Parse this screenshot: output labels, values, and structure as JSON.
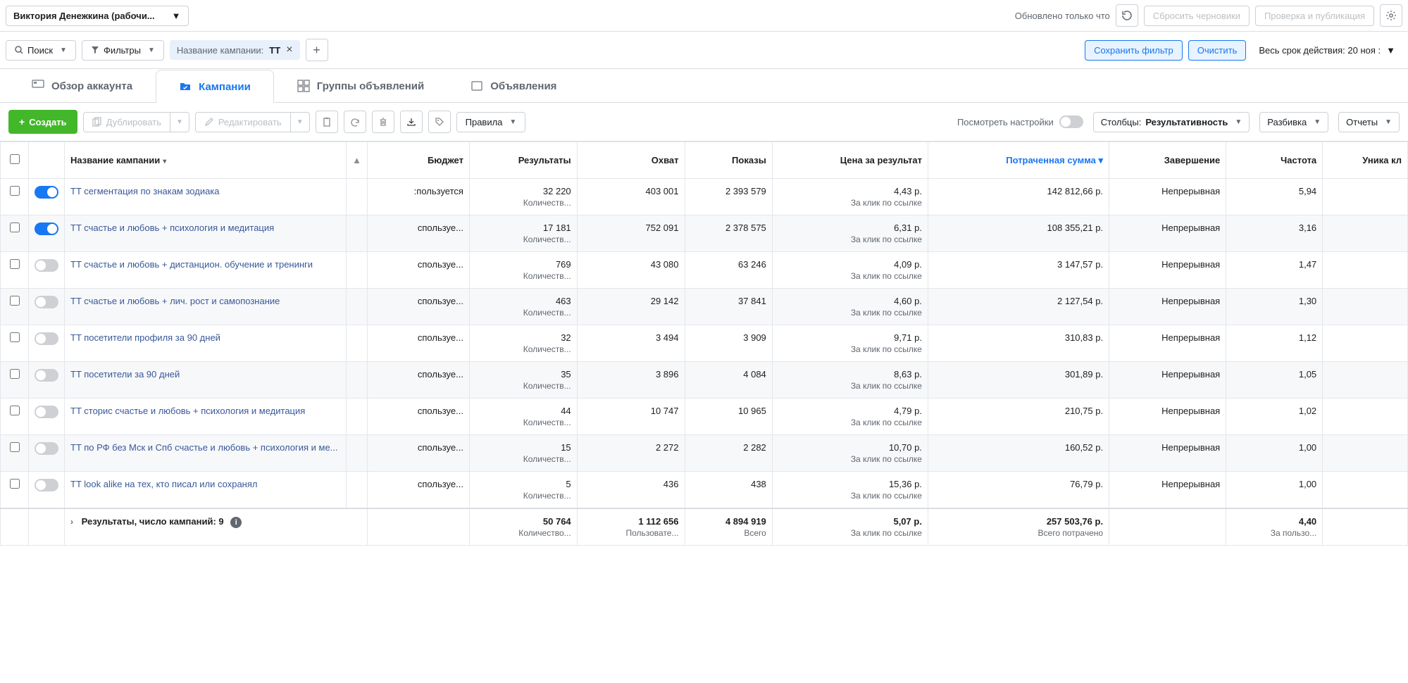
{
  "topbar": {
    "account": "Виктория Денежкина (рабочи...",
    "updated": "Обновлено только что",
    "discard": "Сбросить черновики",
    "review": "Проверка и публикация"
  },
  "filterbar": {
    "search": "Поиск",
    "filters": "Фильтры",
    "chip": {
      "label": "Название кампании:",
      "value": "TT"
    },
    "save": "Сохранить фильтр",
    "clear": "Очистить",
    "daterange": "Весь срок действия: 20 ноя :"
  },
  "tabs": {
    "overview": "Обзор аккаунта",
    "campaigns": "Кампании",
    "adsets": "Группы объявлений",
    "ads": "Объявления"
  },
  "toolbar": {
    "create": "Создать",
    "duplicate": "Дублировать",
    "edit": "Редактировать",
    "rules": "Правила",
    "preview": "Посмотреть настройки",
    "columns_lbl": "Столбцы:",
    "columns_val": "Результативность",
    "breakdown": "Разбивка",
    "reports": "Отчеты"
  },
  "columns": {
    "name": "Название кампании",
    "budget": "Бюджет",
    "results": "Результаты",
    "reach": "Охват",
    "impressions": "Показы",
    "cpr": "Цена за результат",
    "spent": "Потраченная сумма",
    "ends": "Завершение",
    "frequency": "Частота",
    "unique": "Уника кл"
  },
  "rows": [
    {
      "on": true,
      "name": "TT сегментация по знакам зодиака",
      "budget": ":пользуется",
      "results": "32 220",
      "res_sub": "Количеств...",
      "reach": "403 001",
      "imp": "2 393 579",
      "cpr": "4,43 р.",
      "cpr_sub": "За клик по ссылке",
      "spent": "142 812,66 р.",
      "ends": "Непрерывная",
      "freq": "5,94"
    },
    {
      "on": true,
      "name": "TT счастье и любовь + психология и медитация",
      "budget": "спользуе...",
      "results": "17 181",
      "res_sub": "Количеств...",
      "reach": "752 091",
      "imp": "2 378 575",
      "cpr": "6,31 р.",
      "cpr_sub": "За клик по ссылке",
      "spent": "108 355,21 р.",
      "ends": "Непрерывная",
      "freq": "3,16"
    },
    {
      "on": false,
      "name": "TT счастье и любовь + дистанцион. обучение и тренинги",
      "budget": "спользуе...",
      "results": "769",
      "res_sub": "Количеств...",
      "reach": "43 080",
      "imp": "63 246",
      "cpr": "4,09 р.",
      "cpr_sub": "За клик по ссылке",
      "spent": "3 147,57 р.",
      "ends": "Непрерывная",
      "freq": "1,47"
    },
    {
      "on": false,
      "name": "TT счастье и любовь + лич. рост и самопознание",
      "budget": "спользуе...",
      "results": "463",
      "res_sub": "Количеств...",
      "reach": "29 142",
      "imp": "37 841",
      "cpr": "4,60 р.",
      "cpr_sub": "За клик по ссылке",
      "spent": "2 127,54 р.",
      "ends": "Непрерывная",
      "freq": "1,30"
    },
    {
      "on": false,
      "name": "TT посетители профиля за 90 дней",
      "budget": "спользуе...",
      "results": "32",
      "res_sub": "Количеств...",
      "reach": "3 494",
      "imp": "3 909",
      "cpr": "9,71 р.",
      "cpr_sub": "За клик по ссылке",
      "spent": "310,83 р.",
      "ends": "Непрерывная",
      "freq": "1,12"
    },
    {
      "on": false,
      "name": "TT посетители за 90 дней",
      "budget": "спользуе...",
      "results": "35",
      "res_sub": "Количеств...",
      "reach": "3 896",
      "imp": "4 084",
      "cpr": "8,63 р.",
      "cpr_sub": "За клик по ссылке",
      "spent": "301,89 р.",
      "ends": "Непрерывная",
      "freq": "1,05"
    },
    {
      "on": false,
      "name": "TT сторис счастье и любовь + психология и медитация",
      "budget": "спользуе...",
      "results": "44",
      "res_sub": "Количеств...",
      "reach": "10 747",
      "imp": "10 965",
      "cpr": "4,79 р.",
      "cpr_sub": "За клик по ссылке",
      "spent": "210,75 р.",
      "ends": "Непрерывная",
      "freq": "1,02"
    },
    {
      "on": false,
      "name": "TT по РФ без Мск и Спб счастье и любовь + психология и ме...",
      "budget": "спользуе...",
      "results": "15",
      "res_sub": "Количеств...",
      "reach": "2 272",
      "imp": "2 282",
      "cpr": "10,70 р.",
      "cpr_sub": "За клик по ссылке",
      "spent": "160,52 р.",
      "ends": "Непрерывная",
      "freq": "1,00"
    },
    {
      "on": false,
      "name": "TT look alike на тех, кто писал или сохранял",
      "budget": "спользуе...",
      "results": "5",
      "res_sub": "Количеств...",
      "reach": "436",
      "imp": "438",
      "cpr": "15,36 р.",
      "cpr_sub": "За клик по ссылке",
      "spent": "76,79 р.",
      "ends": "Непрерывная",
      "freq": "1,00"
    }
  ],
  "footer": {
    "label": "Результаты, число кампаний: 9",
    "results": "50 764",
    "res_sub": "Количество...",
    "reach": "1 112 656",
    "reach_sub": "Пользовате...",
    "imp": "4 894 919",
    "imp_sub": "Всего",
    "cpr": "5,07 р.",
    "cpr_sub": "За клик по ссылке",
    "spent": "257 503,76 р.",
    "spent_sub": "Всего потрачено",
    "freq": "4,40",
    "freq_sub": "За пользо..."
  }
}
